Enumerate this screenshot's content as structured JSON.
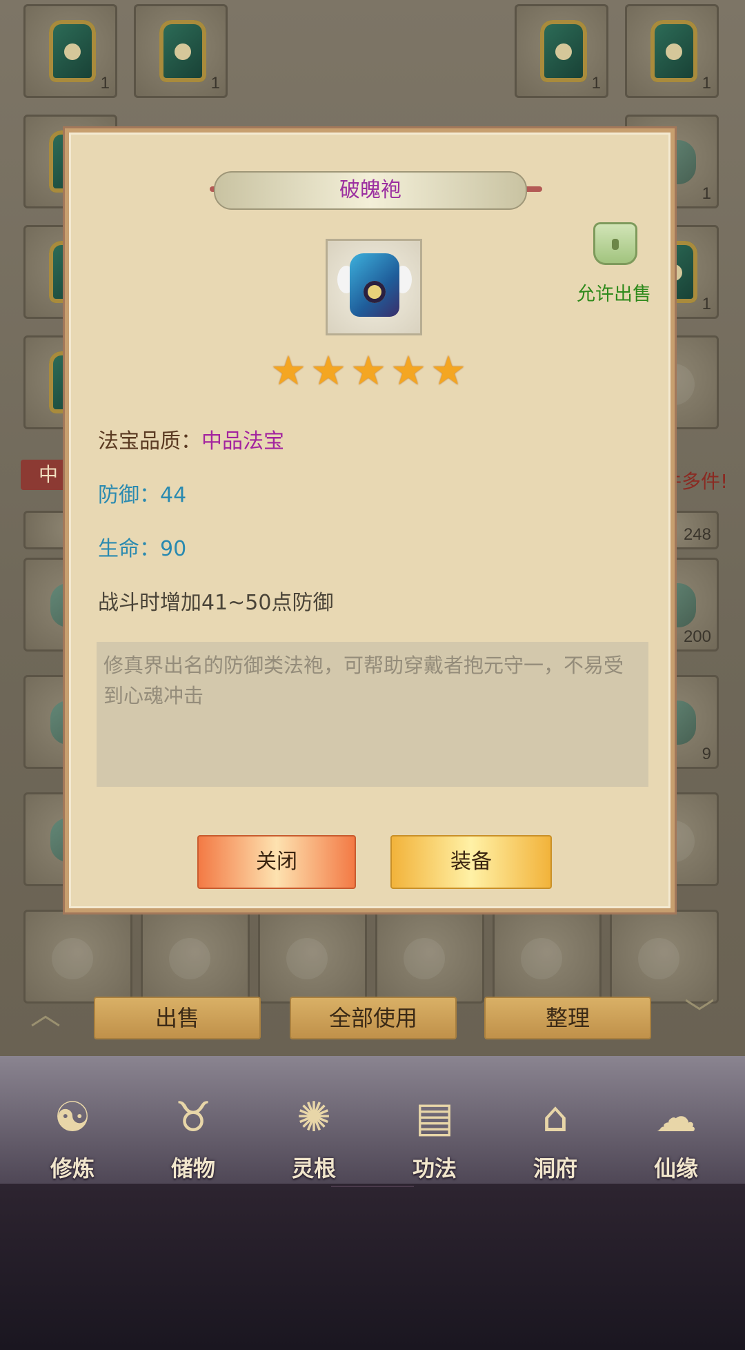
{
  "inventory": {
    "counts_top": [
      "1",
      "1",
      "1",
      "1"
    ],
    "count_right_1": "1",
    "count_right_2": "1",
    "stack_counts": [
      "248",
      "200",
      "9"
    ],
    "banner_left": "中",
    "banner_right": "件多件!"
  },
  "actions": {
    "sell": "出售",
    "use_all": "全部使用",
    "sort": "整理"
  },
  "nav": [
    {
      "label": "修炼",
      "icon": "cultivation-icon"
    },
    {
      "label": "储物",
      "icon": "storage-bag-icon"
    },
    {
      "label": "灵根",
      "icon": "spirit-root-icon"
    },
    {
      "label": "功法",
      "icon": "technique-book-icon"
    },
    {
      "label": "洞府",
      "icon": "cave-house-icon"
    },
    {
      "label": "仙缘",
      "icon": "immortal-fate-icon"
    }
  ],
  "dialog": {
    "title": "破魄袍",
    "lock_label": "允许出售",
    "stars": 5,
    "quality_label": "法宝品质：",
    "quality_value": "中品法宝",
    "defense": "防御：44",
    "hp": "生命：90",
    "effect": "战斗时增加41~50点防御",
    "description": "修真界出名的防御类法袍，可帮助穿戴者抱元守一，不易受到心魂冲击",
    "close_button": "关闭",
    "equip_button": "装备"
  },
  "colors": {
    "quality": "#a3249f",
    "stat": "#2a8ab0",
    "title": "#9b2ea0",
    "lock_label": "#2f8a1c"
  }
}
